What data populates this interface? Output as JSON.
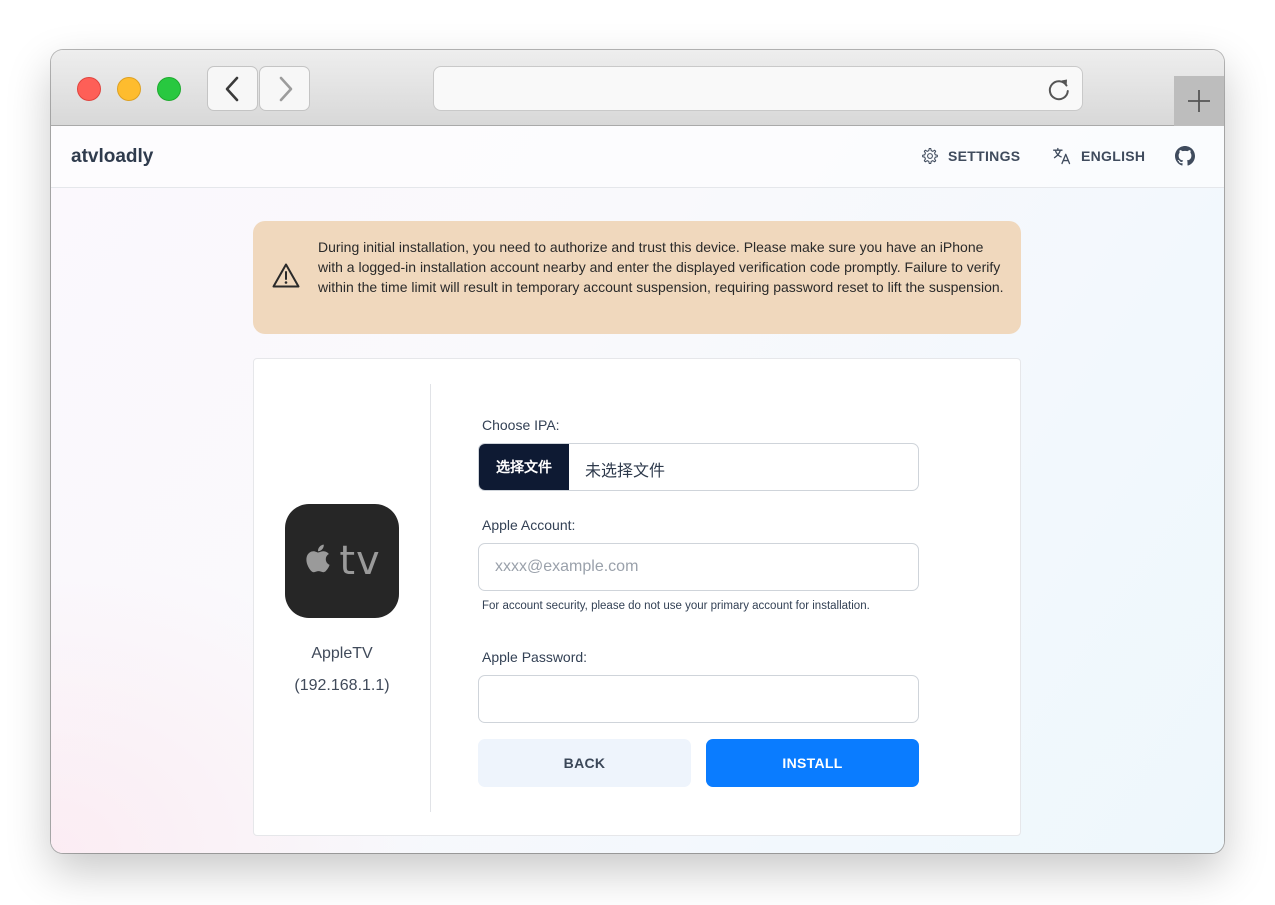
{
  "browser": {
    "nav_back_icon": "chevron-left-icon",
    "nav_forward_icon": "chevron-right-icon",
    "reload_icon": "reload-icon",
    "new_tab_icon": "plus-icon"
  },
  "header": {
    "brand": "atvloadly",
    "settings_label": "SETTINGS",
    "settings_icon": "gear-icon",
    "language_label": "ENGLISH",
    "language_icon": "translate-icon",
    "github_icon": "github-icon"
  },
  "alert": {
    "icon": "warning-icon",
    "text": "During initial installation, you need to authorize and trust this device. Please make sure you have an iPhone with a logged-in installation account nearby and enter the displayed verification code promptly. Failure to verify within the time limit will result in temporary account suspension, requiring password reset to lift the suspension."
  },
  "device": {
    "icon": "apple-tv-icon",
    "icon_text": "tv",
    "name": "AppleTV",
    "ip": "(192.168.1.1)"
  },
  "form": {
    "ipa_label": "Choose IPA:",
    "file_button": "选择文件",
    "file_status": "未选择文件",
    "account_label": "Apple Account:",
    "account_placeholder": "xxxx@example.com",
    "account_value": "",
    "account_hint": "For account security, please do not use your primary account for installation.",
    "password_label": "Apple Password:",
    "password_value": "",
    "back_button": "BACK",
    "install_button": "INSTALL"
  },
  "colors": {
    "alert_bg": "#f0d8bd",
    "primary": "#0a7cff",
    "file_button_bg": "#0e1a33",
    "back_button_bg": "#eef4fc"
  }
}
